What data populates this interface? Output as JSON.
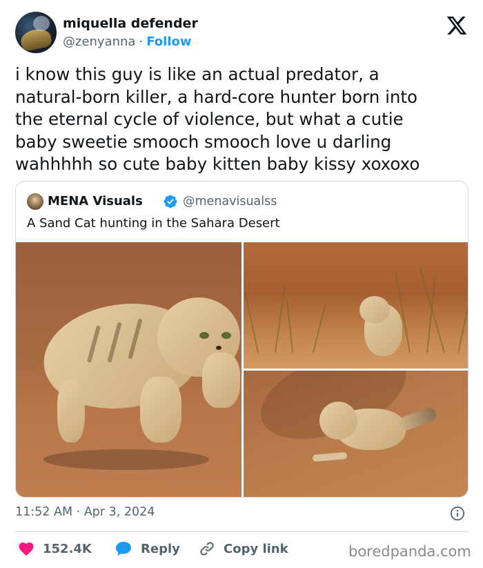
{
  "author": {
    "name": "miquella defender",
    "handle": "@zenyanna",
    "separator": "·",
    "follow_label": "Follow",
    "avatar_icon": "avatar-image"
  },
  "brand_icon": "x-logo-icon",
  "tweet": {
    "lines": [
      "i know this guy is like an actual predator, a",
      "natural-born killer, a hard-core hunter born into",
      "the eternal cycle of violence, but what a cutie",
      "baby sweetie smooch smooch love u darling",
      "wahhhhh so cute baby kitten baby kissy xoxoxo"
    ]
  },
  "quote": {
    "name": "MENA Visuals",
    "handle": "@menavisualss",
    "verified_icon": "verified-badge-icon",
    "text": "A Sand Cat hunting in the Sahara Desert",
    "media_count": 3
  },
  "meta": {
    "time": "11:52 AM",
    "separator": "·",
    "date": "Apr 3, 2024",
    "info_icon": "info-icon"
  },
  "actions": {
    "like_count": "152.4K",
    "reply_label": "Reply",
    "copy_label": "Copy link"
  },
  "watermark": "boredpanda.com",
  "colors": {
    "link": "#1d9bf0",
    "like": "#f91880",
    "secondary_text": "#536471",
    "border": "#cfd9de"
  }
}
